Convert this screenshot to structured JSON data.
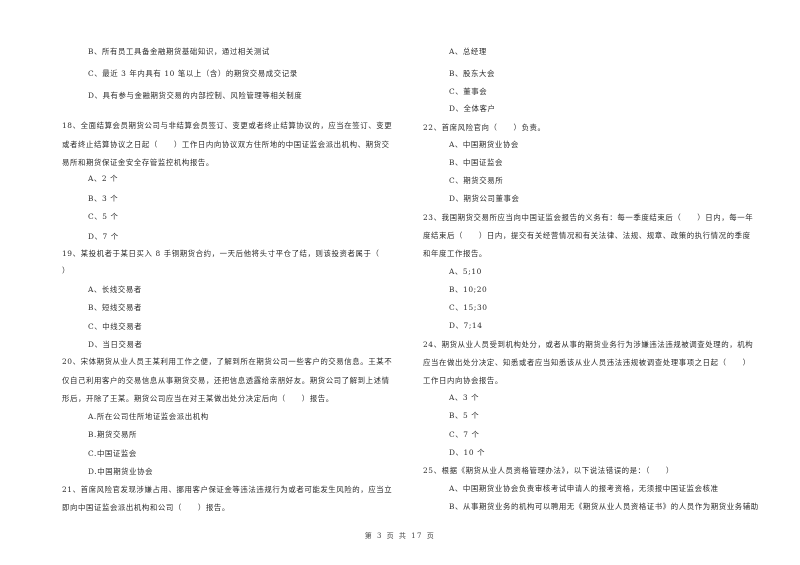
{
  "document": {
    "footer": "第 3 页 共 17 页",
    "left_column": [
      {
        "type": "option",
        "text": "B、所有员工具备金融期货基础知识，通过相关测试"
      },
      {
        "type": "option",
        "text": "C、最近 3 年内具有 10 笔以上（含）的期货交易成交记录"
      },
      {
        "type": "option",
        "text": "D、具有参与金融期货交易的内部控制、风险管理等相关制度"
      },
      {
        "type": "question",
        "text": "18、全面结算会员期货公司与非结算会员签订、变更或者终止结算协议的，应当在签订、变更"
      },
      {
        "type": "question",
        "text": "或者终止结算协议之日起（　　）工作日内向协议双方住所地的中国证监会派出机构、期货交"
      },
      {
        "type": "question",
        "text": "易所和期货保证金安全存管监控机构报告。"
      },
      {
        "type": "option",
        "text": "A、2 个"
      },
      {
        "type": "option",
        "text": "B、3 个"
      },
      {
        "type": "option",
        "text": "C、5 个"
      },
      {
        "type": "option",
        "text": "D、7 个"
      },
      {
        "type": "question",
        "text": "19、某投机者于某日买入 8 手铜期货合约，一天后他将头寸平仓了结，则该投资者属于（"
      },
      {
        "type": "question",
        "text": "）"
      },
      {
        "type": "option",
        "text": "A、长线交易者"
      },
      {
        "type": "option",
        "text": "B、短线交易者"
      },
      {
        "type": "option",
        "text": "C、中线交易者"
      },
      {
        "type": "option",
        "text": "D、当日交易者"
      },
      {
        "type": "question",
        "text": "20、宋体期货从业人员王某利用工作之便，了解到所在期货公司一些客户的交易信息。王某不"
      },
      {
        "type": "question",
        "text": "仅自己利用客户的交易信息从事期货交易，还把信息透露给亲朋好友。期货公司了解到上述情"
      },
      {
        "type": "question",
        "text": "形后，开除了王某。期货公司应当在对王某做出处分决定后向（　　）报告。"
      },
      {
        "type": "option",
        "text": "A.所在公司住所地证监会派出机构"
      },
      {
        "type": "option",
        "text": "B.期货交易所"
      },
      {
        "type": "option",
        "text": "C.中国证监会"
      },
      {
        "type": "option",
        "text": "D.中国期货业协会"
      },
      {
        "type": "question",
        "text": "21、首席风险官发现涉嫌占用、挪用客户保证金等违法违规行为或者可能发生风险的，应当立"
      },
      {
        "type": "question",
        "text": "即向中国证监会派出机构和公司（　　）报告。"
      }
    ],
    "right_column": [
      {
        "type": "option",
        "text": "A、总经理"
      },
      {
        "type": "option",
        "text": "B、股东大会"
      },
      {
        "type": "option",
        "text": "C、董事会"
      },
      {
        "type": "option",
        "text": "D、全体客户"
      },
      {
        "type": "question",
        "text": "22、首席风险官向（　　）负责。"
      },
      {
        "type": "option",
        "text": "A、中国期货业协会"
      },
      {
        "type": "option",
        "text": "B、中国证监会"
      },
      {
        "type": "option",
        "text": "C、期货交易所"
      },
      {
        "type": "option",
        "text": "D、期货公司董事会"
      },
      {
        "type": "question",
        "text": "23、我国期货交易所应当向中国证监会报告的义务有：每一季度结束后（　　）日内，每一年"
      },
      {
        "type": "question",
        "text": "度结束后（　　）日内，提交有关经营情况和有关法律、法规、规章、政策的执行情况的季度"
      },
      {
        "type": "question",
        "text": "和年度工作报告。"
      },
      {
        "type": "option",
        "text": "A、5;10"
      },
      {
        "type": "option",
        "text": "B、10;20"
      },
      {
        "type": "option",
        "text": "C、15;30"
      },
      {
        "type": "option",
        "text": "D、7;14"
      },
      {
        "type": "question",
        "text": "24、期货从业人员受到机构处分，或者从事的期货业务行为涉嫌违法违规被调查处理的，机构"
      },
      {
        "type": "question",
        "text": "应当在做出处分决定、知悉或者应当知悉该从业人员违法违规被调查处理事项之日起（　　）"
      },
      {
        "type": "question",
        "text": "工作日内向协会报告。"
      },
      {
        "type": "option",
        "text": "A、3 个"
      },
      {
        "type": "option",
        "text": "B、5 个"
      },
      {
        "type": "option",
        "text": "C、7 个"
      },
      {
        "type": "option",
        "text": "D、10 个"
      },
      {
        "type": "question",
        "text": "25、根据《期货从业人员资格管理办法》，以下说法错误的是：（　　）"
      },
      {
        "type": "option",
        "text": "A、中国期货业协会负责审核考试申请人的报考资格，无须报中国证监会核准"
      },
      {
        "type": "option",
        "text": "B、从事期货业务的机构可以聘用无《期货从业人员资格证书》的人员作为期货业务辅助"
      }
    ]
  }
}
